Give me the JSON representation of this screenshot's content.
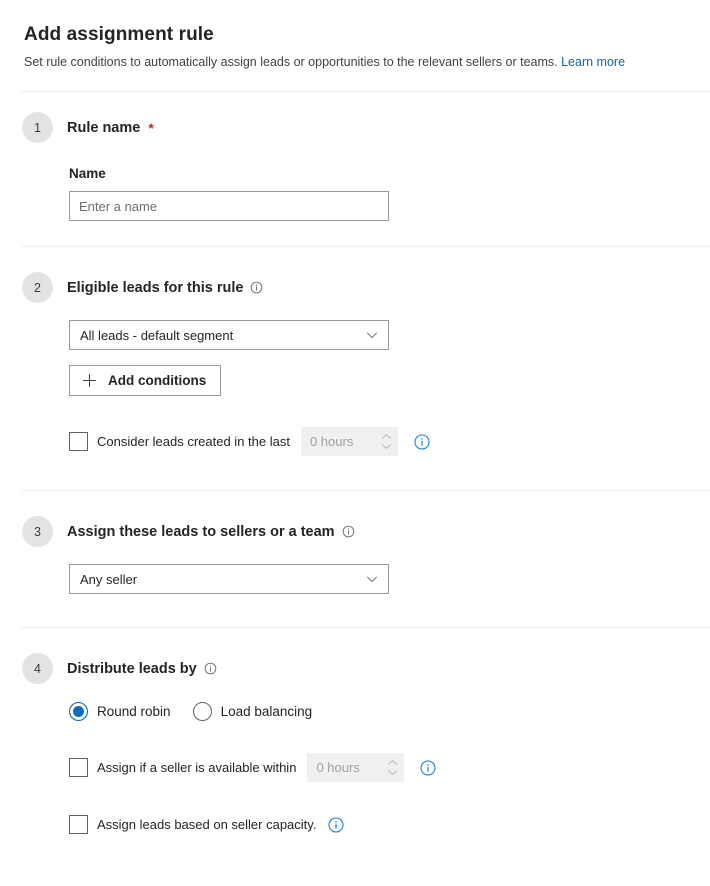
{
  "header": {
    "title": "Add assignment rule",
    "subtitle": "Set rule conditions to automatically assign leads or opportunities to the relevant sellers or teams.",
    "learn_more": "Learn more"
  },
  "sections": [
    {
      "step": "1",
      "title": "Rule name",
      "required_marker": "*",
      "field_label": "Name",
      "input_placeholder": "Enter a name",
      "input_value": ""
    },
    {
      "step": "2",
      "title": "Eligible leads for this rule",
      "info_icon": "info-circle-icon",
      "dropdown_value": "All leads - default segment",
      "dropdown_icon": "chevron-down-icon",
      "add_conditions_label": "Add conditions",
      "add_conditions_icon": "plus-icon",
      "checkbox_label": "Consider leads created in the last",
      "checkbox_checked": false,
      "spinner_value": "0 hours",
      "spinner_disabled": true,
      "row_info_icon": "info-circle-blue-icon"
    },
    {
      "step": "3",
      "title": "Assign these leads to sellers or a team",
      "info_icon": "info-circle-icon",
      "dropdown_value": "Any seller",
      "dropdown_icon": "chevron-down-icon"
    },
    {
      "step": "4",
      "title": "Distribute leads by",
      "info_icon": "info-circle-icon",
      "radios": [
        {
          "label": "Round robin",
          "selected": true
        },
        {
          "label": "Load balancing",
          "selected": false
        }
      ],
      "checkbox_available_label": "Assign if a seller is available within",
      "checkbox_available_checked": false,
      "spinner_value": "0 hours",
      "spinner_disabled": true,
      "checkbox_capacity_label": "Assign leads based on seller capacity.",
      "checkbox_capacity_checked": false,
      "row_info_icon": "info-circle-blue-icon"
    }
  ],
  "colors": {
    "accent_blue": "#0f6cbd",
    "link_blue": "#1264a3",
    "required_red": "#c02b2b",
    "step_badge_bg": "#e3e3e3",
    "divider": "#ebebeb",
    "disabled_field_bg": "#f0f0f0"
  }
}
